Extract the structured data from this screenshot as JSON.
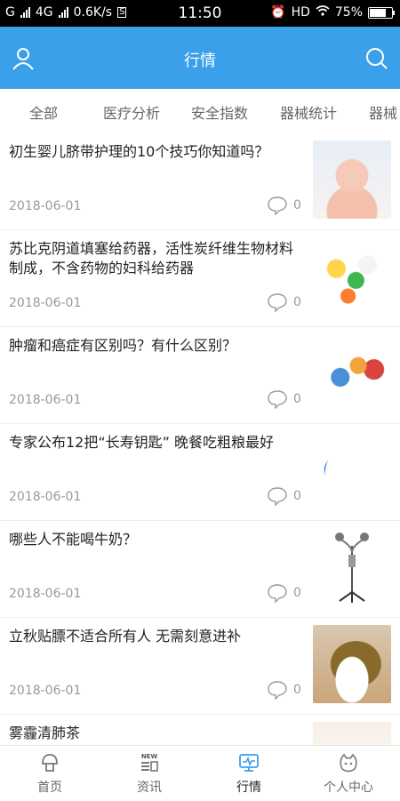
{
  "status_bar": {
    "carrier1": "G",
    "network": "4G",
    "speed": "0.6K/s",
    "speed_badge": "S",
    "time": "11:50",
    "hd": "HD",
    "battery": "75%"
  },
  "header": {
    "title": "行情",
    "user_icon": "user-icon",
    "search_icon": "search-icon"
  },
  "tabs": [
    "全部",
    "医疗分析",
    "安全指数",
    "器械统计",
    "器械"
  ],
  "articles": [
    {
      "title": "初生婴儿脐带护理的10个技巧你知道吗？",
      "date": "2018-06-01",
      "comments": "0"
    },
    {
      "title": "苏比克阴道填塞给药器，活性炭纤维生物材料制成，不含药物的妇科给药器",
      "date": "2018-06-01",
      "comments": "0"
    },
    {
      "title": "肿瘤和癌症有区别吗？有什么区别？",
      "date": "2018-06-01",
      "comments": "0"
    },
    {
      "title": "专家公布12把“长寿钥匙” 晚餐吃粗粮最好",
      "date": "2018-06-01",
      "comments": "0"
    },
    {
      "title": "哪些人不能喝牛奶？",
      "date": "2018-06-01",
      "comments": "0"
    },
    {
      "title": "立秋贴膘不适合所有人 无需刻意进补",
      "date": "2018-06-01",
      "comments": "0"
    },
    {
      "title": "雾霾清肺茶",
      "date": "",
      "comments": ""
    }
  ],
  "tabbar": [
    {
      "label": "首页",
      "icon": "home-icon"
    },
    {
      "label": "资讯",
      "icon": "news-icon",
      "badge": "NEW"
    },
    {
      "label": "行情",
      "icon": "market-icon"
    },
    {
      "label": "个人中心",
      "icon": "profile-icon"
    }
  ],
  "colors": {
    "header": "#3aa0ea",
    "active_icon": "#3aa0ea"
  }
}
